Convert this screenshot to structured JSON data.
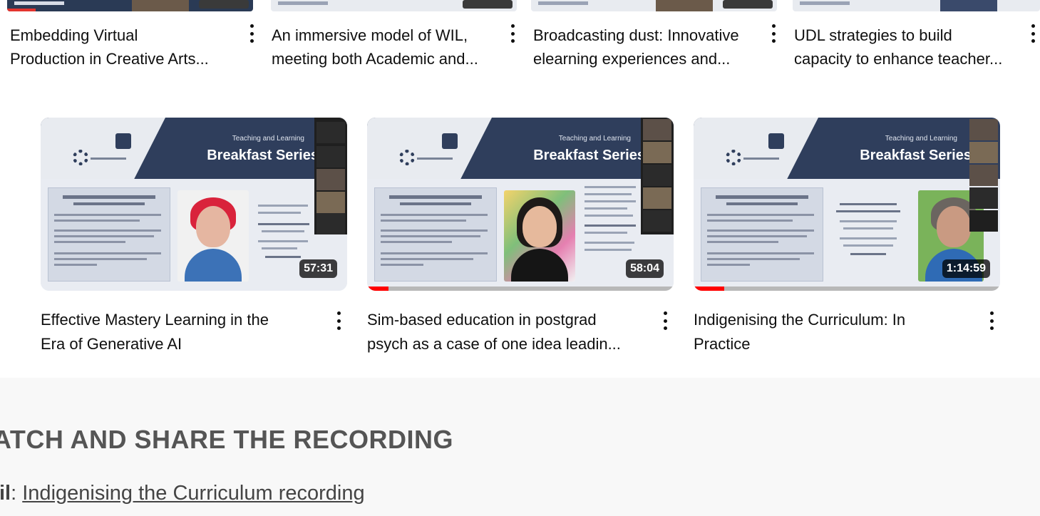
{
  "top_row": [
    {
      "title_line1": "Embedding Virtual",
      "title_line2": "Production in Creative Arts..."
    },
    {
      "title_line1": "An immersive model of WIL,",
      "title_line2": "meeting both Academic and..."
    },
    {
      "title_line1": "Broadcasting dust: Innovative",
      "title_line2": "elearning experiences and..."
    },
    {
      "title_line1": "UDL strategies to build",
      "title_line2": "capacity to enhance teacher..."
    }
  ],
  "videos": [
    {
      "thumb_kicker": "Teaching and Learning",
      "thumb_brand": "Breakfast Series",
      "duration": "57:31",
      "progress_fraction": 0,
      "title_line1": "Effective Mastery Learning in the",
      "title_line2": "Era of Generative AI"
    },
    {
      "thumb_kicker": "Teaching and Learning",
      "thumb_brand": "Breakfast Series",
      "duration": "58:04",
      "progress_fraction": 0.07,
      "title_line1": "Sim-based education in postgrad",
      "title_line2": "psych as a case of one idea leadin..."
    },
    {
      "thumb_kicker": "Teaching and Learning",
      "thumb_brand": "Breakfast Series",
      "duration": "1:14:59",
      "progress_fraction": 0.1,
      "title_line1": "Indigenising the Curriculum: In",
      "title_line2": "Practice"
    }
  ],
  "section": {
    "heading": "ATCH AND SHARE THE RECORDING",
    "link_label": "il",
    "link_sep": ":",
    "link_text": "Indigenising the Curriculum recording"
  },
  "colors": {
    "progress_red": "#ff0000",
    "thumb_header": "#2f3e5c"
  },
  "icons": {
    "more": "more-vert-icon"
  }
}
